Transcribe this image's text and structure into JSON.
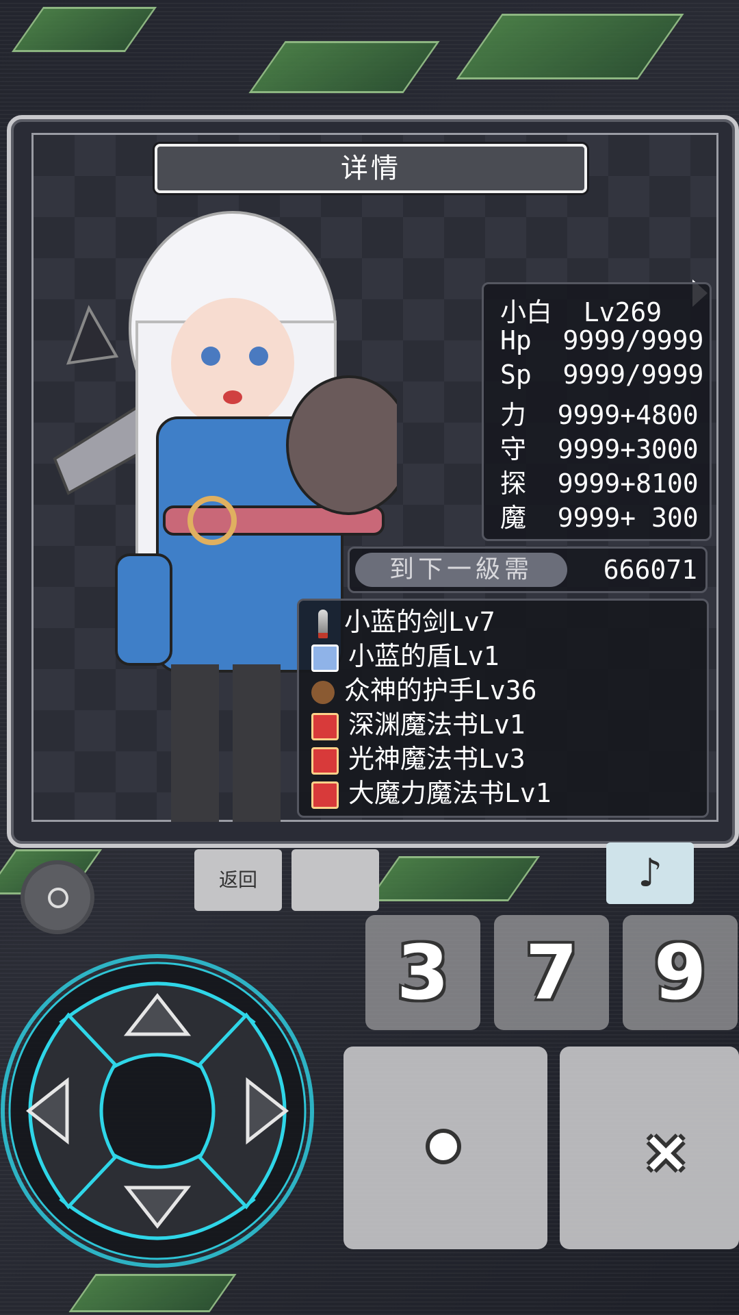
{
  "dialog": {
    "title": "详情"
  },
  "stats": {
    "name_level": "小白  Lv269",
    "rows": [
      "Hp  9999/9999",
      "Sp  9999/9999",
      "力  9999+4800",
      "守  9999+3000",
      "探  9999+8100",
      "魔  9999+ 300"
    ]
  },
  "next_level": {
    "label": "到下一級需",
    "value": "666071"
  },
  "equipment": [
    {
      "icon": "sword-icon",
      "name": "小蓝的剑Lv7"
    },
    {
      "icon": "shield-icon",
      "name": "小蓝的盾Lv1"
    },
    {
      "icon": "glove-icon",
      "name": "众神的护手Lv36"
    },
    {
      "icon": "book-icon",
      "name": "深渊魔法书Lv1"
    },
    {
      "icon": "book-icon",
      "name": "光神魔法书Lv3"
    },
    {
      "icon": "book-icon",
      "name": "大魔力魔法书Lv1"
    }
  ],
  "controls": {
    "back_label": "返回",
    "music_label": "♪",
    "num_buttons": [
      "3",
      "7",
      "9"
    ],
    "cancel_label": "×"
  },
  "colors": {
    "dpad_glow": "#2fd6e8",
    "panel_border": "#c8c8cc"
  }
}
